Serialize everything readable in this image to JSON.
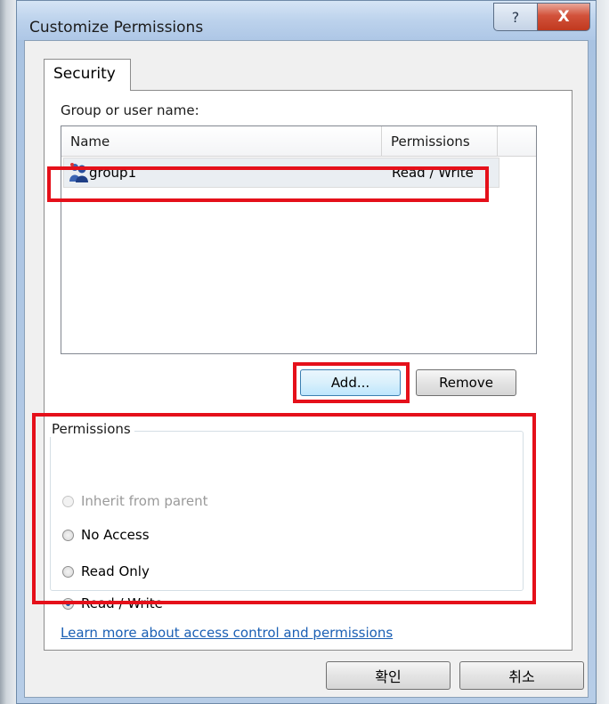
{
  "window": {
    "title": "Customize Permissions",
    "help_glyph": "?",
    "close_glyph": "X"
  },
  "tab": {
    "label": "Security"
  },
  "group_section": {
    "label": "Group or user name:",
    "columns": [
      "Name",
      "Permissions"
    ],
    "rows": [
      {
        "name": "group1",
        "permission": "Read / Write",
        "icon": "group-icon",
        "selected": true
      }
    ]
  },
  "buttons": {
    "add": "Add...",
    "remove": "Remove"
  },
  "permissions": {
    "label": "Permissions",
    "options": [
      {
        "label": "Inherit from parent",
        "checked": false,
        "disabled": true
      },
      {
        "label": "No Access",
        "checked": false,
        "disabled": false
      },
      {
        "label": "Read Only",
        "checked": false,
        "disabled": false
      },
      {
        "label": "Read / Write",
        "checked": true,
        "disabled": false
      }
    ]
  },
  "link": "Learn more about access control and permissions",
  "footer": {
    "ok": "확인",
    "cancel": "취소"
  },
  "colors": {
    "highlight": "#e5101a",
    "link": "#1a5fb4",
    "close_button": "#c0391f"
  }
}
